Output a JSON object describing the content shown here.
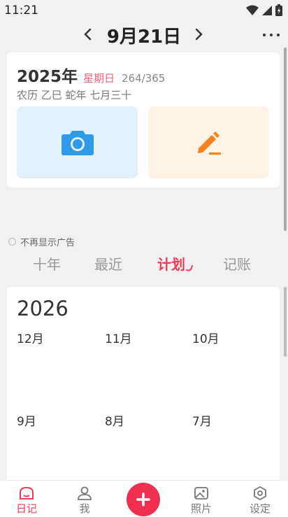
{
  "status": {
    "time": "11:21"
  },
  "header": {
    "date_title": "9月21日"
  },
  "today": {
    "year": "2025年",
    "weekday": "星期日",
    "day_of_year": "264/365",
    "lunar": "农历  乙巳 蛇年 七月三十"
  },
  "ad": {
    "label": "不再显示广告"
  },
  "tabs": [
    {
      "label": "十年"
    },
    {
      "label": "最近"
    },
    {
      "label": "计划"
    },
    {
      "label": "记账"
    }
  ],
  "plan": {
    "year": "2026",
    "months": [
      "12月",
      "11月",
      "10月",
      "9月",
      "8月",
      "7月"
    ]
  },
  "bottom_nav": {
    "diary": "日记",
    "me": "我",
    "photos": "照片",
    "settings": "设定"
  },
  "colors": {
    "accent": "#ee3c57",
    "camera_bg": "#e2f0fb",
    "edit_bg": "#fff3e6"
  }
}
